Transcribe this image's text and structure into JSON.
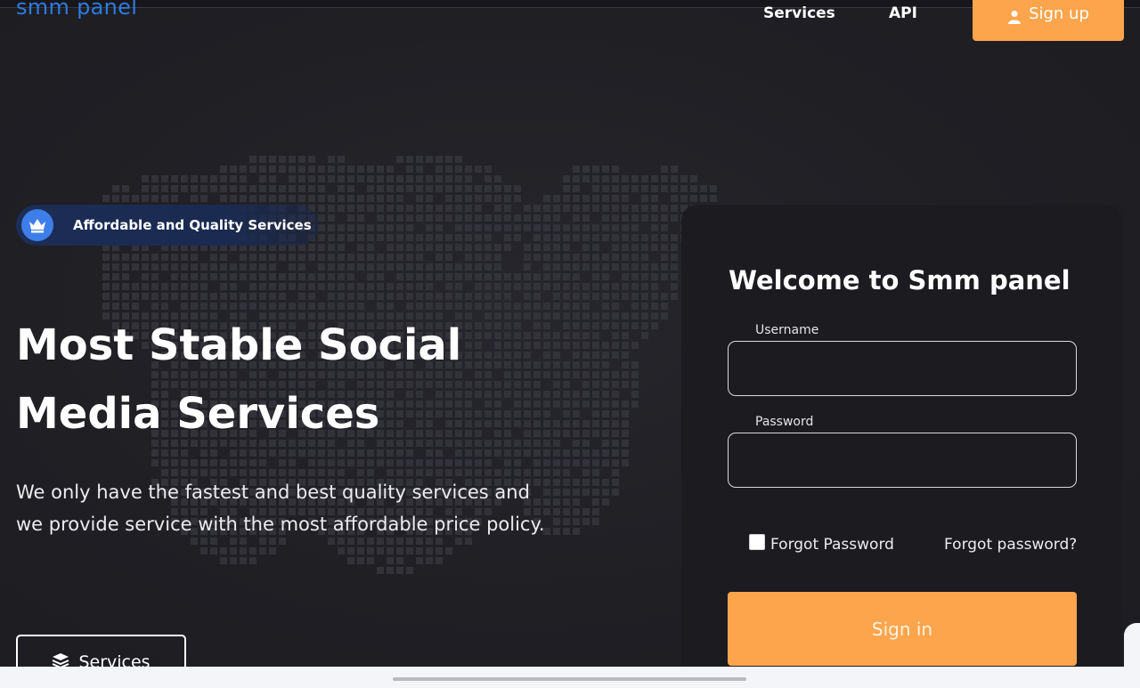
{
  "header": {
    "brand": "smm panel",
    "nav": {
      "services": "Services",
      "api": "API"
    },
    "signup": {
      "label": "Sign up",
      "icon": "user-icon"
    }
  },
  "hero": {
    "badge": {
      "text": "Affordable and Quality Services",
      "icon": "crown-icon"
    },
    "headline_line1": "Most Stable Social",
    "headline_line2": "Media Services",
    "description": "We only have the fastest and best quality services and we provide service with the most affordable price policy.",
    "services_button": {
      "label": "Services",
      "icon": "layers-icon"
    }
  },
  "login": {
    "title": "Welcome to  Smm panel",
    "username_label": "Username",
    "username_value": "",
    "password_label": "Password",
    "password_value": "",
    "remember_label": "Forgot Password",
    "forgot_link": "Forgot password?",
    "signin_label": "Sign in"
  },
  "colors": {
    "background": "#1f1f24",
    "accent_orange": "#fca54c",
    "brand_blue": "#2d7be0",
    "badge_blue": "#3d7ee8",
    "card": "#1b1b20"
  }
}
